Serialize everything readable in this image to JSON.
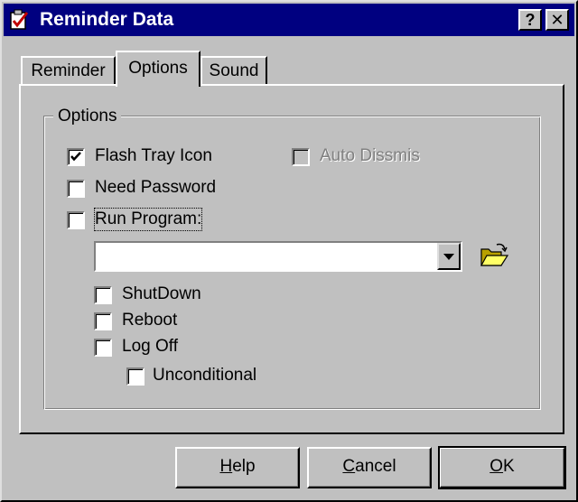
{
  "window": {
    "title": "Reminder Data",
    "title_icon": "checklist-icon",
    "help_button": "?",
    "close_button": "✕"
  },
  "tabs": [
    {
      "label": "Reminder",
      "active": false
    },
    {
      "label": "Options",
      "active": true
    },
    {
      "label": "Sound",
      "active": false
    }
  ],
  "options_group": {
    "legend": "Options",
    "flash_tray_icon": {
      "label": "Flash Tray Icon",
      "checked": true
    },
    "auto_dismiss": {
      "label": "Auto Dissmis",
      "checked": false,
      "enabled": false
    },
    "need_password": {
      "label": "Need Password",
      "checked": false
    },
    "run_program": {
      "label": "Run Program:",
      "checked": false,
      "focused": true
    },
    "program_combo": {
      "value": ""
    },
    "browse_icon": "open-folder-icon",
    "shutdown": {
      "label": "ShutDown",
      "checked": false
    },
    "reboot": {
      "label": "Reboot",
      "checked": false
    },
    "log_off": {
      "label": "Log Off",
      "checked": false
    },
    "unconditional": {
      "label": "Unconditional",
      "checked": false
    }
  },
  "buttons": {
    "help": {
      "prefix": "",
      "mnemonic": "H",
      "suffix": "elp"
    },
    "cancel": {
      "prefix": "",
      "mnemonic": "C",
      "suffix": "ancel"
    },
    "ok": {
      "prefix": "",
      "mnemonic": "O",
      "suffix": "K"
    }
  }
}
